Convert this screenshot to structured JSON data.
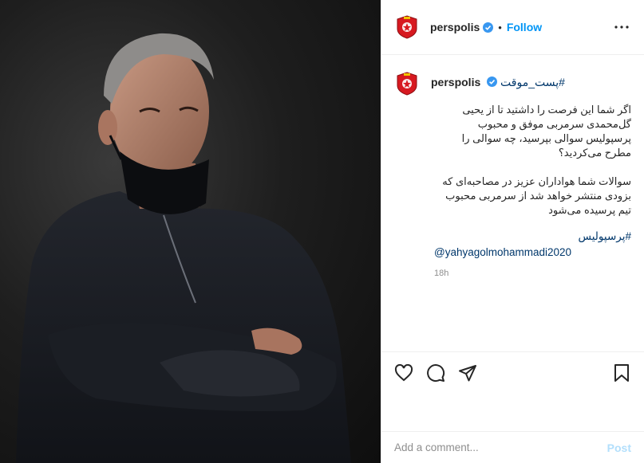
{
  "account": {
    "username": "perspolis",
    "verified": true,
    "separator": "•",
    "follow_label": "Follow"
  },
  "caption": {
    "username": "perspolis",
    "hashtag_top": "#پست_موقت",
    "paragraph_1": "اگر شما این فرصت را داشتید تا از یحیی گل‌محمدی سرمربی موفق و محبوب پرسپولیس سوالی بپرسید، چه سوالی را مطرح می‌کردید؟",
    "paragraph_2": "سوالات شما هواداران عزیز در مصاحبه‌ای که بزودی منتشر خواهد شد از سرمربی محبوب تیم پرسیده می‌شود",
    "hashtag_bottom": "#پرسپولیس",
    "mention": "@yahyagolmohammadi2020",
    "time": "18h"
  },
  "icons": {
    "header_avatar": "club-logo",
    "verified": "verified-badge-icon",
    "more": "more-options-icon",
    "like": "heart-icon",
    "comment": "comment-icon",
    "share": "share-icon",
    "save": "bookmark-icon"
  },
  "comment_box": {
    "placeholder": "Add a comment...",
    "post_label": "Post"
  },
  "colors": {
    "accent": "#0095f6",
    "link": "#00376b",
    "muted": "#8e8e8e",
    "post_disabled": "#b2dffc",
    "logo_red": "#d71920"
  }
}
